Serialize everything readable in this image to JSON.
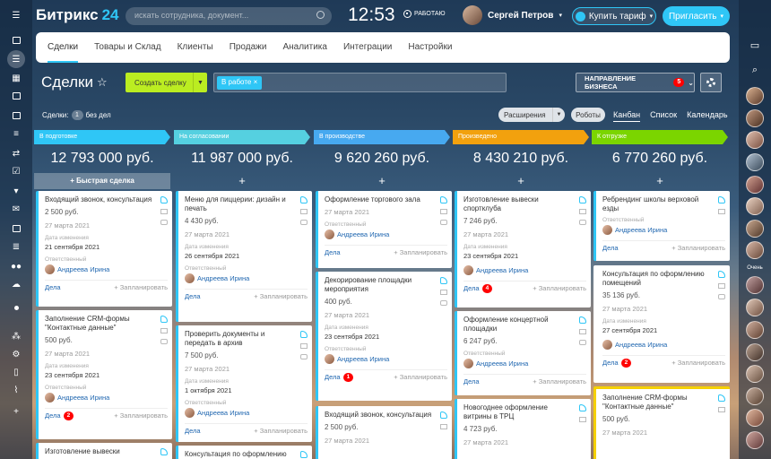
{
  "app": {
    "logo": "Битрикс",
    "logo_num": "24",
    "search_placeholder": "искать сотрудника, документ...",
    "clock": "12:53",
    "work_status": "РАБОТАЮ",
    "user_name": "Сергей Петров",
    "buy_label": "Купить тариф",
    "invite_label": "Пригласить"
  },
  "nav": {
    "tabs": [
      "Сделки",
      "Товары и Склад",
      "Клиенты",
      "Продажи",
      "Аналитика",
      "Интеграции",
      "Настройки"
    ]
  },
  "page": {
    "title": "Сделки",
    "create_label": "Создать сделку",
    "filter_tag": "В работе",
    "direction_label": "НАПРАВЛЕНИЕ БИЗНЕСА",
    "direction_badge": "5",
    "deals_label": "Сделки:",
    "deals_count": "1",
    "deals_suffix": "без дел",
    "extensions_label": "Расширения",
    "robots_label": "Роботы",
    "views": [
      "Канбан",
      "Список",
      "Календарь"
    ],
    "fast_deal": "+ Быстрая сделка",
    "plus": "+"
  },
  "labels": {
    "changed": "Дата изменения",
    "responsible": "Ответственный",
    "tasks": "Дела",
    "planned": "+ Запланировать"
  },
  "sidebar": {
    "right_label": "Очень"
  },
  "columns": [
    {
      "name": "В подготовке",
      "color": "#2fc6f6",
      "total": "12 793 000 руб."
    },
    {
      "name": "На согласовании",
      "color": "#55d0e0",
      "total": "11 987 000 руб."
    },
    {
      "name": "В производстве",
      "color": "#47a9f0",
      "total": "9 620 260 руб."
    },
    {
      "name": "Произведено",
      "color": "#f2a10e",
      "total": "8 430 210 руб."
    },
    {
      "name": "К отгрузке",
      "color": "#7bd500",
      "total": "6 770 260 руб."
    }
  ],
  "cards": [
    {
      "title": "Входящий звонок, консультация",
      "price": "2 500 руб.",
      "date": "27 марта 2021",
      "changed": "21 сентября 2021",
      "person": "Андреева Ирина",
      "badge": ""
    },
    {
      "title": "Заполнение CRM-формы \"Контактные данные\"",
      "price": "500 руб.",
      "date": "27 марта 2021",
      "changed": "23 сентября 2021",
      "person": "Андреева Ирина",
      "badge": "2"
    },
    {
      "title": "Изготовление вывески"
    },
    {
      "title": "Меню для пиццерии: дизайн и печать",
      "price": "4 430 руб.",
      "date": "27 марта 2021",
      "changed": "26 сентября 2021",
      "person": "Андреева Ирина",
      "badge": ""
    },
    {
      "title": "Проверить документы и передать в архив",
      "price": "7 500 руб.",
      "date": "27 марта 2021",
      "changed": "1 октября 2021",
      "person": "Андреева Ирина",
      "badge": ""
    },
    {
      "title": "Консультация по оформлению"
    },
    {
      "title": "Оформление торгового зала",
      "date": "27 марта 2021",
      "person": "Андреева Ирина",
      "badge": ""
    },
    {
      "title": "Декорирование площадки мероприятия",
      "price": "400 руб.",
      "date": "27 марта 2021",
      "changed": "23 сентября 2021",
      "person": "Андреева Ирина",
      "badge": "1"
    },
    {
      "title": "Входящий звонок, консультация",
      "price": "2 500 руб.",
      "date": "27 марта 2021"
    },
    {
      "title": "Изготовление вывески спортклуба",
      "price": "7 246 руб.",
      "date": "27 марта 2021",
      "changed": "23 сентября 2021",
      "person": "Андреева Ирина",
      "badge": "4"
    },
    {
      "title": "Оформление концертной площадки",
      "price": "6 247 руб.",
      "person": "Андреева Ирина",
      "badge": ""
    },
    {
      "title": "Новогоднее оформление витрины в ТРЦ",
      "price": "4 723 руб.",
      "date": "27 марта 2021"
    },
    {
      "title": "Ребрендинг школы верховой езды",
      "person": "Андреева Ирина",
      "badge": ""
    },
    {
      "title": "Консультация по оформлению помещений",
      "price": "35 136 руб.",
      "date": "27 марта 2021",
      "changed": "27 сентября 2021",
      "person": "Андреева Ирина",
      "badge": "2"
    },
    {
      "title": "Заполнение CRM-формы \"Контактные данные\"",
      "price": "500 руб.",
      "date": "27 марта 2021"
    }
  ]
}
